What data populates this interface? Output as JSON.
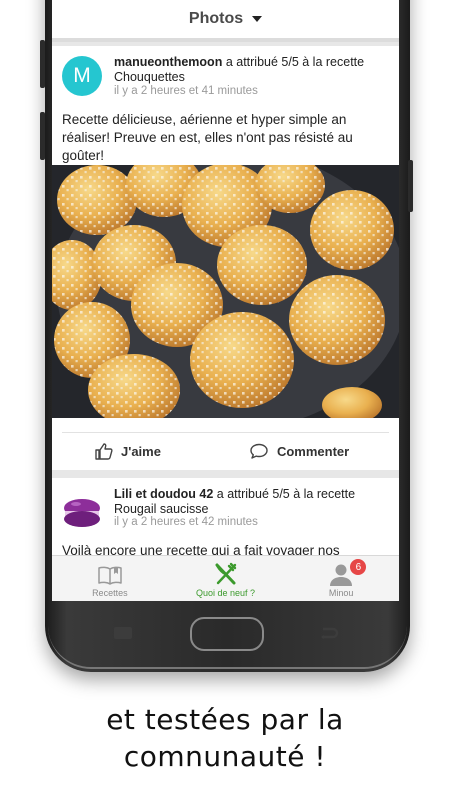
{
  "header": {
    "title": "Photos"
  },
  "posts": [
    {
      "avatar_letter": "M",
      "avatar_color": "#25c6d0",
      "user": "manueonthemoon",
      "action": " a attribué 5/5 à la recette",
      "recipe": "Chouquettes",
      "time": "il y a 2 heures et 41 minutes",
      "text": "Recette délicieuse, aérienne et hyper simple an réaliser! Preuve en est, elles n'ont pas résisté au goûter!",
      "like_label": "J'aime",
      "comment_label": "Commenter"
    },
    {
      "user": "Lili et doudou 42",
      "action": " a attribué 5/5 à la recette",
      "recipe": "Rougail saucisse",
      "time": "il y a 2 heures et 42 minutes",
      "text": "Voilà encore une recette qui a fait voyager nos"
    }
  ],
  "tabs": [
    {
      "label": "Recettes",
      "icon": "book-icon"
    },
    {
      "label": "Quoi de neuf ?",
      "icon": "fork-knife-icon",
      "active": true
    },
    {
      "label": "Minou",
      "icon": "user-icon",
      "badge": "6"
    }
  ],
  "colors": {
    "accent": "#3c9a2d",
    "badge": "#e64646",
    "avatar": "#25c6d0"
  },
  "caption": {
    "line1": "et testées par la",
    "line2": "comnunauté !"
  }
}
